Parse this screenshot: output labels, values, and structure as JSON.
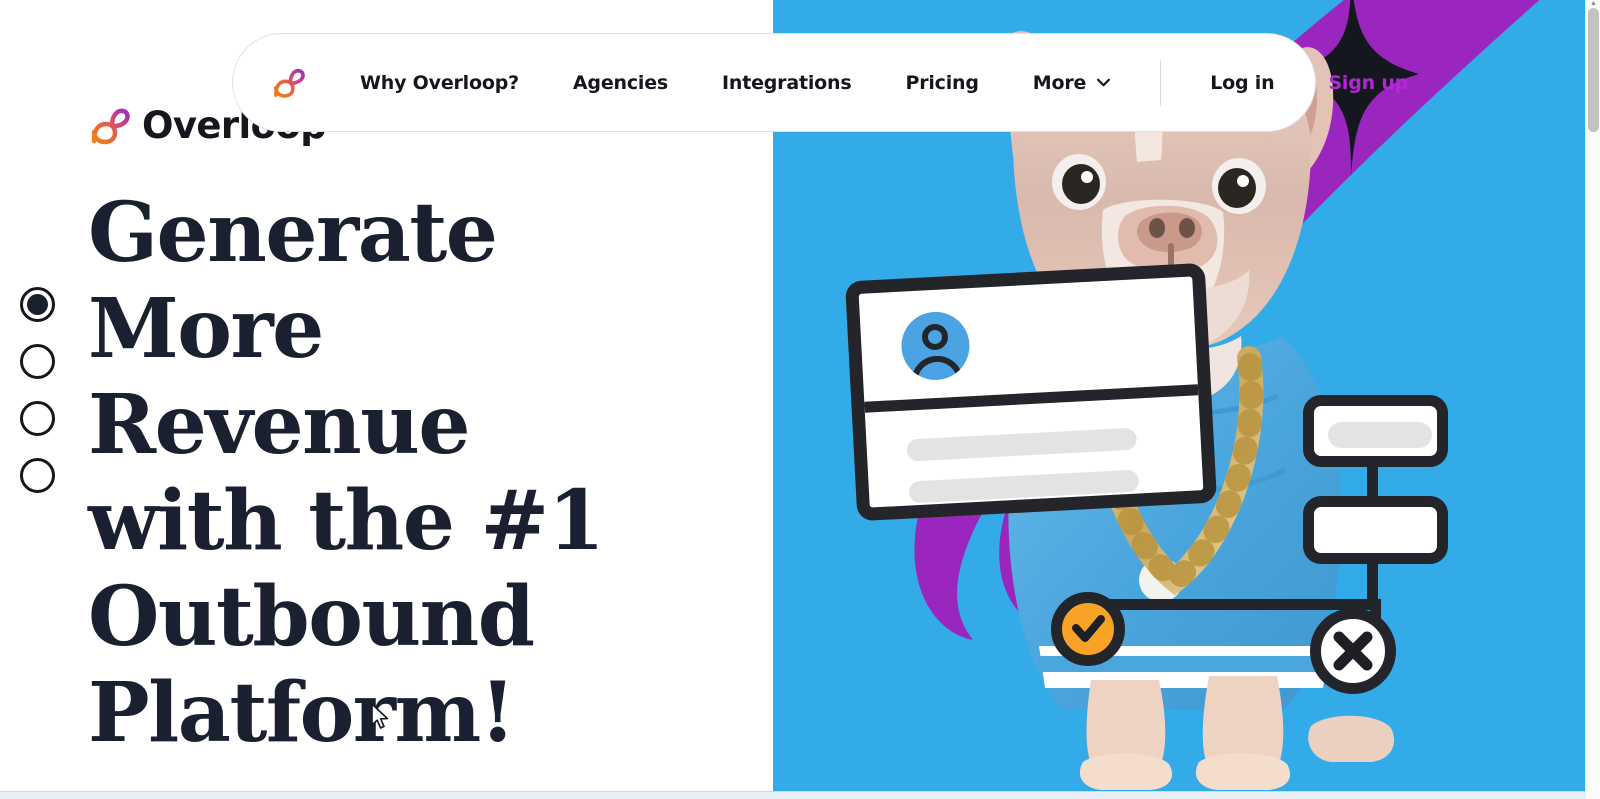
{
  "brand": {
    "name": "Overloop",
    "logo_icon": "overloop-loop-icon",
    "accent_purple": "#b228d6",
    "accent_orange": "#f07a1f",
    "dark": "#15171e"
  },
  "navbar": {
    "logo_icon": "overloop-loop-icon",
    "links": [
      {
        "label": "Why Overloop?",
        "name": "nav-link-why-overloop",
        "style": "default",
        "has_chevron": false
      },
      {
        "label": "Agencies",
        "name": "nav-link-agencies",
        "style": "default",
        "has_chevron": false
      },
      {
        "label": "Integrations",
        "name": "nav-link-integrations",
        "style": "default",
        "has_chevron": false
      },
      {
        "label": "Pricing",
        "name": "nav-link-pricing",
        "style": "default",
        "has_chevron": false
      },
      {
        "label": "More",
        "name": "nav-link-more",
        "style": "default",
        "has_chevron": true
      }
    ],
    "auth": [
      {
        "label": "Log in",
        "name": "nav-link-log-in",
        "style": "default"
      },
      {
        "label": "Sign up",
        "name": "nav-link-sign-up",
        "style": "signup"
      }
    ],
    "chevron_icon": "chevron-down-icon",
    "separator": "vertical-divider"
  },
  "hero": {
    "headline": "Generate More Revenue with the #1 Outbound Platform!",
    "headline_lines": [
      "Generate",
      "More",
      "Revenue",
      "with the #1",
      "Outbound",
      "Platform!"
    ],
    "background_color": "#32abe8",
    "swoosh_color": "#9b26bf",
    "image_alt": "french-bulldog-with-gold-chain-photo"
  },
  "carousel": {
    "dots": [
      {
        "name": "carousel-dot-1",
        "active": true
      },
      {
        "name": "carousel-dot-2",
        "active": false
      },
      {
        "name": "carousel-dot-3",
        "active": false
      },
      {
        "name": "carousel-dot-4",
        "active": false
      }
    ]
  },
  "illustration": {
    "contact_card": {
      "name": "contact-card-graphic",
      "avatar_icon": "person-avatar-icon",
      "skeleton_lines": 2
    },
    "flow": {
      "node_1": "flow-node-with-text-placeholder",
      "node_2": "flow-node-empty",
      "check_badge": "check-badge-icon",
      "check_badge_color": "#f9a326",
      "x_badge": "x-badge-icon"
    },
    "sparkle": "sparkle-star-icon"
  },
  "browser": {
    "scrollbar": "vertical-scrollbar",
    "scrollbar_arrow": "scroll-up-arrow-icon"
  },
  "cursor": {
    "name": "mouse-pointer-cursor"
  }
}
